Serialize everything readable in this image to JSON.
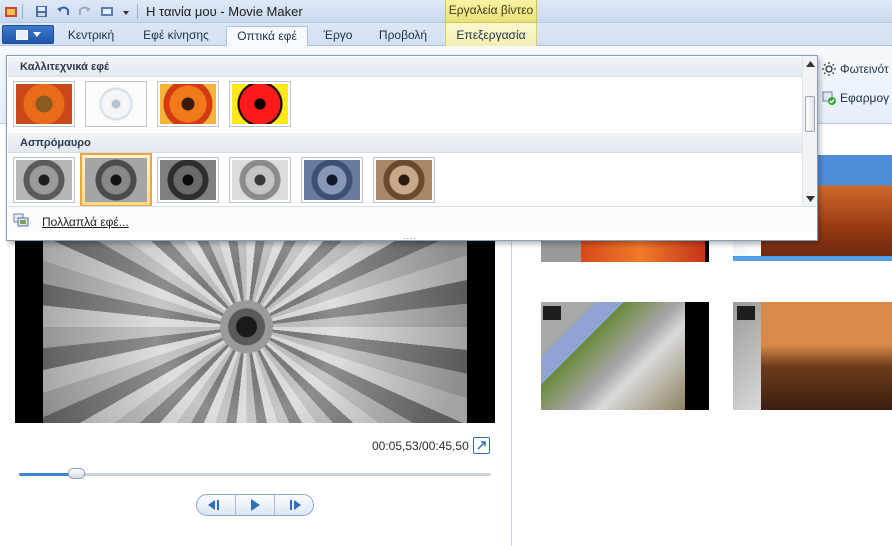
{
  "window": {
    "title": "Η ταινία μου - Movie Maker",
    "contextual_group": "Εργαλεία βίντεο"
  },
  "ribbon": {
    "tabs": [
      {
        "label": "Κεντρική",
        "active": false
      },
      {
        "label": "Εφέ κίνησης",
        "active": false
      },
      {
        "label": "Οπτικά εφέ",
        "active": true
      },
      {
        "label": "Έργο",
        "active": false
      },
      {
        "label": "Προβολή",
        "active": false
      },
      {
        "label": "Επεξεργασία",
        "active": false,
        "contextual": true
      }
    ],
    "brightness_label": "Φωτεινότ",
    "apply_all_label": "Εφαρμογ"
  },
  "gallery": {
    "categories": [
      {
        "name": "Καλλιτεχνικά εφέ",
        "items": [
          "artistic-threshold",
          "artistic-sketch",
          "artistic-posterize",
          "artistic-cyan-red"
        ]
      },
      {
        "name": "Ασπρόμαυρο",
        "items": [
          "bw-standard",
          "bw-selected",
          "bw-dark",
          "bw-light",
          "bw-blue",
          "bw-sepia"
        ]
      }
    ],
    "selected_effect": "bw-selected",
    "more_effects": "Πολλαπλά εφέ...",
    "resize_grip": "...."
  },
  "player": {
    "timecode": "00:05,53/00:45,50",
    "progress": 0.12
  },
  "colors": {
    "accent": "#3b86d6",
    "contextual_tab": "#f3eeb0",
    "selection": "#e8a93a"
  }
}
